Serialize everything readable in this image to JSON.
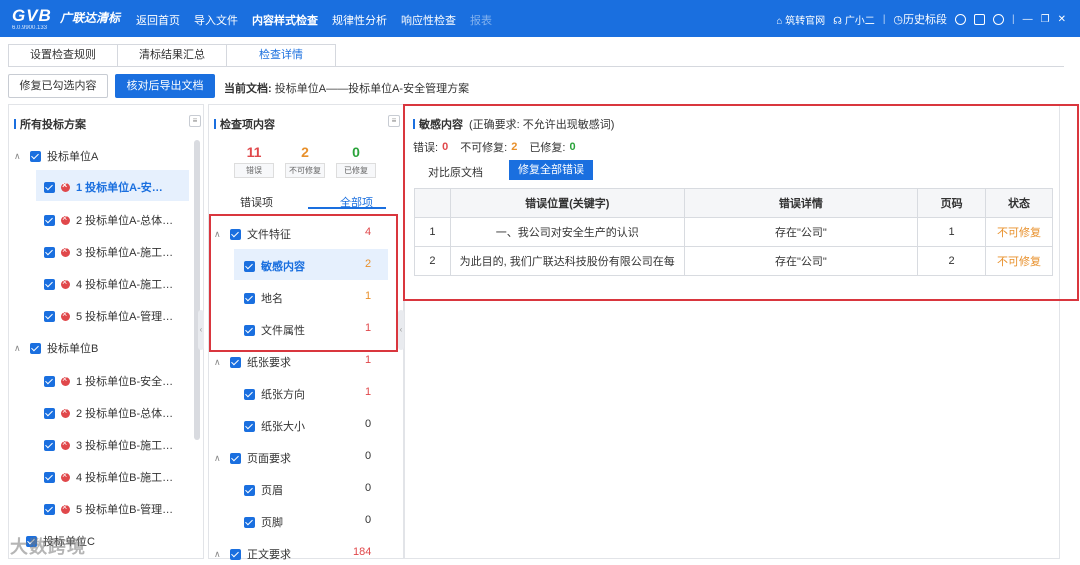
{
  "topbar": {
    "logo": "GVB",
    "logo_cn": "广联达清标",
    "version": "6.0.9900.133",
    "nav": [
      "返回首页",
      "导入文件",
      "内容样式检查",
      "规律性分析",
      "响应性检查",
      "报表"
    ],
    "right": {
      "official": "筑转官网",
      "assistant": "广小二",
      "history": "历史标段",
      "min": "—",
      "restore": "❐",
      "close": "✕"
    }
  },
  "tabs": [
    "设置检查规则",
    "清标结果汇总",
    "检查详情"
  ],
  "toolbar": {
    "fix_selected": "修复已勾选内容",
    "export": "核对后导出文档",
    "current_label": "当前文档:",
    "current_doc": "投标单位A——投标单位A-安全管理方案"
  },
  "left": {
    "title": "所有投标方案",
    "groups": [
      {
        "name": "投标单位A",
        "items": [
          "1 投标单位A-安…",
          "2 投标单位A-总体…",
          "3 投标单位A-施工…",
          "4 投标单位A-施工…",
          "5 投标单位A-管理…"
        ]
      },
      {
        "name": "投标单位B",
        "items": [
          "1 投标单位B-安全…",
          "2 投标单位B-总体…",
          "3 投标单位B-施工…",
          "4 投标单位B-施工…",
          "5 投标单位B-管理…"
        ]
      },
      {
        "name": "投标单位C"
      }
    ]
  },
  "middle": {
    "title": "检查项内容",
    "stats": [
      {
        "n": "11",
        "l": "错误",
        "c": "#e0484b"
      },
      {
        "n": "2",
        "l": "不可修复",
        "c": "#e8902b"
      },
      {
        "n": "0",
        "l": "已修复",
        "c": "#2aa33a"
      }
    ],
    "subtabs": [
      "错误项",
      "全部项"
    ],
    "items": [
      {
        "label": "文件特征",
        "count": "4",
        "level": 0,
        "color": "#e0484b"
      },
      {
        "label": "敏感内容",
        "count": "2",
        "level": 1,
        "color": "#e8902b"
      },
      {
        "label": "地名",
        "count": "1",
        "level": 1,
        "color": "#e8902b"
      },
      {
        "label": "文件属性",
        "count": "1",
        "level": 1,
        "color": "#e0484b"
      },
      {
        "label": "纸张要求",
        "count": "1",
        "level": 0,
        "color": "#e0484b"
      },
      {
        "label": "纸张方向",
        "count": "1",
        "level": 1,
        "color": "#e0484b"
      },
      {
        "label": "纸张大小",
        "count": "0",
        "level": 1,
        "color": "#333"
      },
      {
        "label": "页面要求",
        "count": "0",
        "level": 0,
        "color": "#333"
      },
      {
        "label": "页眉",
        "count": "0",
        "level": 1,
        "color": "#333"
      },
      {
        "label": "页脚",
        "count": "0",
        "level": 1,
        "color": "#333"
      },
      {
        "label": "正文要求",
        "count": "184",
        "level": 0,
        "color": "#e0484b"
      }
    ]
  },
  "detail": {
    "title": "敏感内容",
    "requirement": "(正确要求: 不允许出现敏感词)",
    "err_label": "错误:",
    "err": "0",
    "unfix_label": "不可修复:",
    "unfix": "2",
    "fixed_label": "已修复:",
    "fixed": "0",
    "compare": "对比原文档",
    "fix_all": "修复全部错误",
    "headers": [
      "",
      "错误位置(关键字)",
      "错误详情",
      "页码",
      "状态"
    ],
    "rows": [
      [
        "1",
        "一、我公司对安全生产的认识",
        "存在\"公司\"",
        "1",
        "不可修复"
      ],
      [
        "2",
        "为此目的, 我们广联达科技股份有限公司在每",
        "存在\"公司\"",
        "2",
        "不可修复"
      ]
    ]
  },
  "watermark": "大数跨境"
}
